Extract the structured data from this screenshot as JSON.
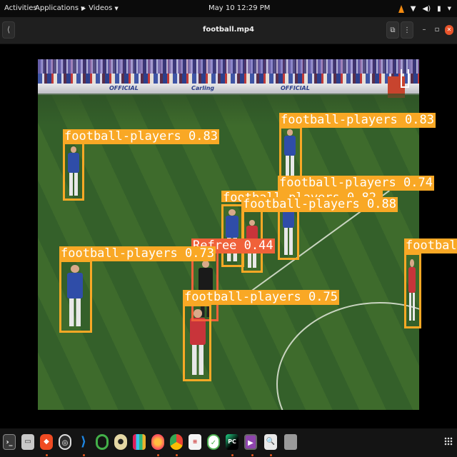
{
  "topbar": {
    "activities": "Activities",
    "applications": "Applications",
    "videos": "Videos",
    "clock": "May 10  12:29 PM"
  },
  "header": {
    "title": "football.mp4"
  },
  "detections": [
    {
      "label": "football-players 0.83"
    },
    {
      "label": "football-players 0.83"
    },
    {
      "label": "football-players 0.74"
    },
    {
      "label": "football-players 0.82"
    },
    {
      "label": "football-players 0.88"
    },
    {
      "label": "Refree 0.44"
    },
    {
      "label": "football-players 0.73"
    },
    {
      "label": "football-players 0.75"
    },
    {
      "label": "footbal"
    }
  ],
  "scoreboards": {
    "brand_1": "OFFICIAL",
    "brand_2": "Carling",
    "brand_3": "OFFICIAL"
  },
  "dock": {
    "icons": [
      "terminal-icon",
      "files-icon",
      "brave-icon",
      "screenshot-icon",
      "vscode-icon",
      "anaconda-icon",
      "camera-icon",
      "slack-icon",
      "firefox-icon",
      "chrome-icon",
      "text-editor-icon",
      "gnome-tweaks-icon",
      "pycharm-icon",
      "video-player-icon",
      "document-viewer-icon",
      "trash-icon"
    ]
  },
  "colors": {
    "player_box": "#f9a825",
    "referee_box": "#f0613a",
    "close_button": "#e9542b"
  }
}
